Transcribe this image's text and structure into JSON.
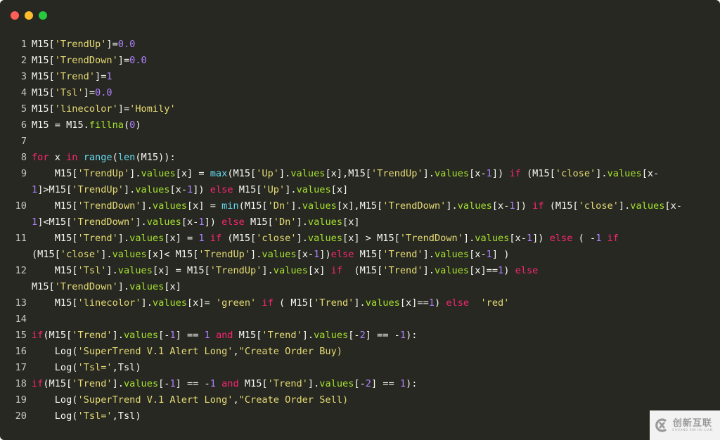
{
  "window": {
    "traffic_lights": [
      {
        "name": "close",
        "color": "#ff5f56"
      },
      {
        "name": "minimize",
        "color": "#ffbd2e"
      },
      {
        "name": "maximize",
        "color": "#27c93f"
      }
    ]
  },
  "theme": {
    "background": "#272822",
    "plain": "#f8f8f2",
    "string": "#e6db74",
    "number": "#ae81ff",
    "keyword": "#f92672",
    "builtin": "#66d9ef",
    "attribute": "#a6e22e"
  },
  "code": {
    "language": "python",
    "visual_lines": [
      {
        "num": "1",
        "tokens": [
          [
            "plain",
            "M15["
          ],
          [
            "str",
            "'TrendUp'"
          ],
          [
            "plain",
            "]="
          ],
          [
            "num",
            "0.0"
          ]
        ]
      },
      {
        "num": "2",
        "tokens": [
          [
            "plain",
            "M15["
          ],
          [
            "str",
            "'TrendDown'"
          ],
          [
            "plain",
            "]="
          ],
          [
            "num",
            "0.0"
          ]
        ]
      },
      {
        "num": "3",
        "tokens": [
          [
            "plain",
            "M15["
          ],
          [
            "str",
            "'Trend'"
          ],
          [
            "plain",
            "]="
          ],
          [
            "num",
            "1"
          ]
        ]
      },
      {
        "num": "4",
        "tokens": [
          [
            "plain",
            "M15["
          ],
          [
            "str",
            "'Tsl'"
          ],
          [
            "plain",
            "]="
          ],
          [
            "num",
            "0.0"
          ]
        ]
      },
      {
        "num": "5",
        "tokens": [
          [
            "plain",
            "M15["
          ],
          [
            "str",
            "'linecolor'"
          ],
          [
            "plain",
            "]="
          ],
          [
            "str",
            "'Homily'"
          ]
        ]
      },
      {
        "num": "6",
        "tokens": [
          [
            "plain",
            "M15 = M15."
          ],
          [
            "attr",
            "fillna"
          ],
          [
            "plain",
            "("
          ],
          [
            "num",
            "0"
          ],
          [
            "plain",
            ")"
          ]
        ]
      },
      {
        "num": "7",
        "tokens": []
      },
      {
        "num": "8",
        "tokens": [
          [
            "kw",
            "for"
          ],
          [
            "plain",
            " x "
          ],
          [
            "kw",
            "in"
          ],
          [
            "plain",
            " "
          ],
          [
            "builtin",
            "range"
          ],
          [
            "plain",
            "("
          ],
          [
            "builtin",
            "len"
          ],
          [
            "plain",
            "(M15)):"
          ]
        ]
      },
      {
        "num": "9",
        "tokens": [
          [
            "plain",
            "    M15["
          ],
          [
            "str",
            "'TrendUp'"
          ],
          [
            "plain",
            "]."
          ],
          [
            "attr",
            "values"
          ],
          [
            "plain",
            "[x] = "
          ],
          [
            "builtin",
            "max"
          ],
          [
            "plain",
            "(M15["
          ],
          [
            "str",
            "'Up'"
          ],
          [
            "plain",
            "]."
          ],
          [
            "attr",
            "values"
          ],
          [
            "plain",
            "[x],M15["
          ],
          [
            "str",
            "'TrendUp'"
          ],
          [
            "plain",
            "]."
          ],
          [
            "attr",
            "values"
          ],
          [
            "plain",
            "[x-"
          ],
          [
            "num",
            "1"
          ],
          [
            "plain",
            "]) "
          ],
          [
            "kw",
            "if"
          ],
          [
            "plain",
            " (M15["
          ],
          [
            "str",
            "'close'"
          ],
          [
            "plain",
            "]."
          ],
          [
            "attr",
            "values"
          ],
          [
            "plain",
            "[x-"
          ]
        ]
      },
      {
        "num": "",
        "tokens": [
          [
            "num",
            "1"
          ],
          [
            "plain",
            "]>M15["
          ],
          [
            "str",
            "'TrendUp'"
          ],
          [
            "plain",
            "]."
          ],
          [
            "attr",
            "values"
          ],
          [
            "plain",
            "[x-"
          ],
          [
            "num",
            "1"
          ],
          [
            "plain",
            "]) "
          ],
          [
            "kw",
            "else"
          ],
          [
            "plain",
            " M15["
          ],
          [
            "str",
            "'Up'"
          ],
          [
            "plain",
            "]."
          ],
          [
            "attr",
            "values"
          ],
          [
            "plain",
            "[x]"
          ]
        ]
      },
      {
        "num": "10",
        "tokens": [
          [
            "plain",
            "    M15["
          ],
          [
            "str",
            "'TrendDown'"
          ],
          [
            "plain",
            "]."
          ],
          [
            "attr",
            "values"
          ],
          [
            "plain",
            "[x] = "
          ],
          [
            "builtin",
            "min"
          ],
          [
            "plain",
            "(M15["
          ],
          [
            "str",
            "'Dn'"
          ],
          [
            "plain",
            "]."
          ],
          [
            "attr",
            "values"
          ],
          [
            "plain",
            "[x],M15["
          ],
          [
            "str",
            "'TrendDown'"
          ],
          [
            "plain",
            "]."
          ],
          [
            "attr",
            "values"
          ],
          [
            "plain",
            "[x-"
          ],
          [
            "num",
            "1"
          ],
          [
            "plain",
            "]) "
          ],
          [
            "kw",
            "if"
          ],
          [
            "plain",
            " (M15["
          ],
          [
            "str",
            "'close'"
          ],
          [
            "plain",
            "]."
          ],
          [
            "attr",
            "values"
          ],
          [
            "plain",
            "[x-"
          ]
        ]
      },
      {
        "num": "",
        "tokens": [
          [
            "num",
            "1"
          ],
          [
            "plain",
            "]<M15["
          ],
          [
            "str",
            "'TrendDown'"
          ],
          [
            "plain",
            "]."
          ],
          [
            "attr",
            "values"
          ],
          [
            "plain",
            "[x-"
          ],
          [
            "num",
            "1"
          ],
          [
            "plain",
            "]) "
          ],
          [
            "kw",
            "else"
          ],
          [
            "plain",
            " M15["
          ],
          [
            "str",
            "'Dn'"
          ],
          [
            "plain",
            "]."
          ],
          [
            "attr",
            "values"
          ],
          [
            "plain",
            "[x]"
          ]
        ]
      },
      {
        "num": "11",
        "tokens": [
          [
            "plain",
            "    M15["
          ],
          [
            "str",
            "'Trend'"
          ],
          [
            "plain",
            "]."
          ],
          [
            "attr",
            "values"
          ],
          [
            "plain",
            "[x] = "
          ],
          [
            "num",
            "1"
          ],
          [
            "plain",
            " "
          ],
          [
            "kw",
            "if"
          ],
          [
            "plain",
            " (M15["
          ],
          [
            "str",
            "'close'"
          ],
          [
            "plain",
            "]."
          ],
          [
            "attr",
            "values"
          ],
          [
            "plain",
            "[x] > M15["
          ],
          [
            "str",
            "'TrendDown'"
          ],
          [
            "plain",
            "]."
          ],
          [
            "attr",
            "values"
          ],
          [
            "plain",
            "[x-"
          ],
          [
            "num",
            "1"
          ],
          [
            "plain",
            "]) "
          ],
          [
            "kw",
            "else"
          ],
          [
            "plain",
            " ( -"
          ],
          [
            "num",
            "1"
          ],
          [
            "plain",
            " "
          ],
          [
            "kw",
            "if"
          ]
        ]
      },
      {
        "num": "",
        "tokens": [
          [
            "plain",
            "(M15["
          ],
          [
            "str",
            "'close'"
          ],
          [
            "plain",
            "]."
          ],
          [
            "attr",
            "values"
          ],
          [
            "plain",
            "[x]< M15["
          ],
          [
            "str",
            "'TrendUp'"
          ],
          [
            "plain",
            "]."
          ],
          [
            "attr",
            "values"
          ],
          [
            "plain",
            "[x-"
          ],
          [
            "num",
            "1"
          ],
          [
            "plain",
            "])"
          ],
          [
            "kw",
            "else"
          ],
          [
            "plain",
            " M15["
          ],
          [
            "str",
            "'Trend'"
          ],
          [
            "plain",
            "]."
          ],
          [
            "attr",
            "values"
          ],
          [
            "plain",
            "[x-"
          ],
          [
            "num",
            "1"
          ],
          [
            "plain",
            "] )"
          ]
        ]
      },
      {
        "num": "12",
        "tokens": [
          [
            "plain",
            "    M15["
          ],
          [
            "str",
            "'Tsl'"
          ],
          [
            "plain",
            "]."
          ],
          [
            "attr",
            "values"
          ],
          [
            "plain",
            "[x] = M15["
          ],
          [
            "str",
            "'TrendUp'"
          ],
          [
            "plain",
            "]."
          ],
          [
            "attr",
            "values"
          ],
          [
            "plain",
            "[x] "
          ],
          [
            "kw",
            "if"
          ],
          [
            "plain",
            "  (M15["
          ],
          [
            "str",
            "'Trend'"
          ],
          [
            "plain",
            "]."
          ],
          [
            "attr",
            "values"
          ],
          [
            "plain",
            "[x]=="
          ],
          [
            "num",
            "1"
          ],
          [
            "plain",
            ") "
          ],
          [
            "kw",
            "else"
          ]
        ]
      },
      {
        "num": "",
        "tokens": [
          [
            "plain",
            "M15["
          ],
          [
            "str",
            "'TrendDown'"
          ],
          [
            "plain",
            "]."
          ],
          [
            "attr",
            "values"
          ],
          [
            "plain",
            "[x]"
          ]
        ]
      },
      {
        "num": "13",
        "tokens": [
          [
            "plain",
            "    M15["
          ],
          [
            "str",
            "'linecolor'"
          ],
          [
            "plain",
            "]."
          ],
          [
            "attr",
            "values"
          ],
          [
            "plain",
            "[x]= "
          ],
          [
            "str",
            "'green'"
          ],
          [
            "plain",
            " "
          ],
          [
            "kw",
            "if"
          ],
          [
            "plain",
            " ( M15["
          ],
          [
            "str",
            "'Trend'"
          ],
          [
            "plain",
            "]."
          ],
          [
            "attr",
            "values"
          ],
          [
            "plain",
            "[x]=="
          ],
          [
            "num",
            "1"
          ],
          [
            "plain",
            ") "
          ],
          [
            "kw",
            "else"
          ],
          [
            "plain",
            "  "
          ],
          [
            "str",
            "'red'"
          ]
        ]
      },
      {
        "num": "14",
        "tokens": []
      },
      {
        "num": "15",
        "tokens": [
          [
            "kw",
            "if"
          ],
          [
            "plain",
            "(M15["
          ],
          [
            "str",
            "'Trend'"
          ],
          [
            "plain",
            "]."
          ],
          [
            "attr",
            "values"
          ],
          [
            "plain",
            "[-"
          ],
          [
            "num",
            "1"
          ],
          [
            "plain",
            "] == "
          ],
          [
            "num",
            "1"
          ],
          [
            "plain",
            " "
          ],
          [
            "kw",
            "and"
          ],
          [
            "plain",
            " M15["
          ],
          [
            "str",
            "'Trend'"
          ],
          [
            "plain",
            "]."
          ],
          [
            "attr",
            "values"
          ],
          [
            "plain",
            "[-"
          ],
          [
            "num",
            "2"
          ],
          [
            "plain",
            "] == -"
          ],
          [
            "num",
            "1"
          ],
          [
            "plain",
            "):"
          ]
        ]
      },
      {
        "num": "16",
        "tokens": [
          [
            "plain",
            "    Log("
          ],
          [
            "str",
            "'SuperTrend V.1 Alert Long'"
          ],
          [
            "plain",
            ","
          ],
          [
            "str",
            "\"Create Order Buy)"
          ]
        ]
      },
      {
        "num": "17",
        "tokens": [
          [
            "plain",
            "    Log("
          ],
          [
            "str",
            "'Tsl='"
          ],
          [
            "plain",
            ",Tsl)"
          ]
        ]
      },
      {
        "num": "18",
        "tokens": [
          [
            "kw",
            "if"
          ],
          [
            "plain",
            "(M15["
          ],
          [
            "str",
            "'Trend'"
          ],
          [
            "plain",
            "]."
          ],
          [
            "attr",
            "values"
          ],
          [
            "plain",
            "[-"
          ],
          [
            "num",
            "1"
          ],
          [
            "plain",
            "] == -"
          ],
          [
            "num",
            "1"
          ],
          [
            "plain",
            " "
          ],
          [
            "kw",
            "and"
          ],
          [
            "plain",
            " M15["
          ],
          [
            "str",
            "'Trend'"
          ],
          [
            "plain",
            "]."
          ],
          [
            "attr",
            "values"
          ],
          [
            "plain",
            "[-"
          ],
          [
            "num",
            "2"
          ],
          [
            "plain",
            "] == "
          ],
          [
            "num",
            "1"
          ],
          [
            "plain",
            "):"
          ]
        ]
      },
      {
        "num": "19",
        "tokens": [
          [
            "plain",
            "    Log("
          ],
          [
            "str",
            "'SuperTrend V.1 Alert Long'"
          ],
          [
            "plain",
            ","
          ],
          [
            "str",
            "\"Create Order Sell)"
          ]
        ]
      },
      {
        "num": "20",
        "tokens": [
          [
            "plain",
            "    Log("
          ],
          [
            "str",
            "'Tsl='"
          ],
          [
            "plain",
            ",Tsl)"
          ]
        ]
      }
    ]
  },
  "watermark": {
    "logo_icon": "cx-logo-icon",
    "text_cn": "创新互联",
    "text_en": "CHUANG XIN HU LIAN"
  }
}
